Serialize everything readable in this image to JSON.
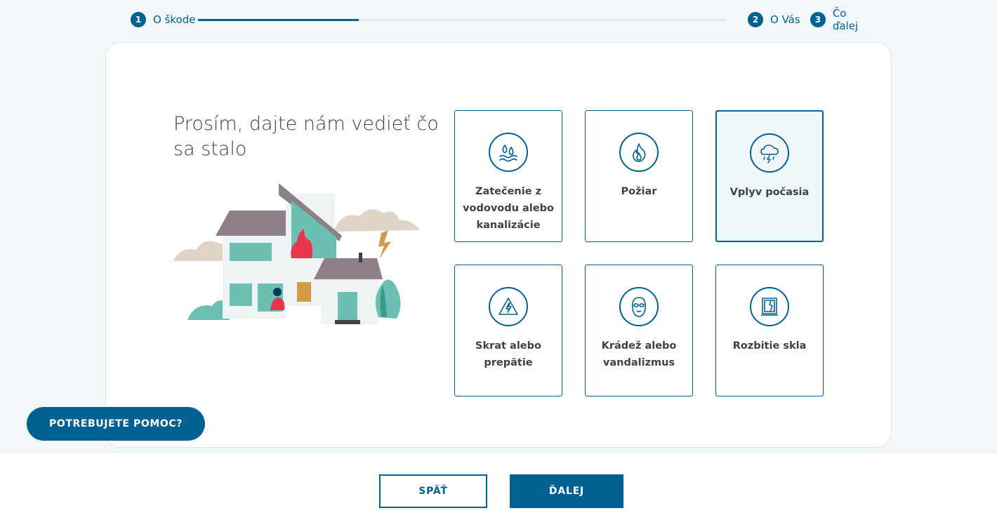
{
  "progress": {
    "steps": [
      {
        "number": "1",
        "label": "O škode"
      },
      {
        "number": "2",
        "label": "O Vás"
      },
      {
        "number": "3",
        "label": "Čo ďalej"
      }
    ],
    "fill_fraction": 0.305
  },
  "main": {
    "heading": "Prosím, dajte nám vedieť čo sa stalo",
    "options": [
      {
        "label": "Zatečenie z vodovodu alebo kanalizácie",
        "icon": "water-drops-icon",
        "selected": false
      },
      {
        "label": "Požiar",
        "icon": "flame-icon",
        "selected": false
      },
      {
        "label": "Vplyv počasia",
        "icon": "storm-cloud-icon",
        "selected": true
      },
      {
        "label": "Skrat alebo prepätie",
        "icon": "high-voltage-icon",
        "selected": false
      },
      {
        "label": "Krádež alebo vandalizmus",
        "icon": "masked-face-icon",
        "selected": false
      },
      {
        "label": "Rozbitie skla",
        "icon": "broken-window-icon",
        "selected": false
      }
    ]
  },
  "help": {
    "label": "POTREBUJETE POMOC?"
  },
  "footer": {
    "back_label": "SPÄŤ",
    "next_label": "ĎALEJ"
  },
  "colors": {
    "primary": "#006192",
    "selected_bg": "#f0f7fa",
    "page_bg": "#f2f7f9"
  }
}
